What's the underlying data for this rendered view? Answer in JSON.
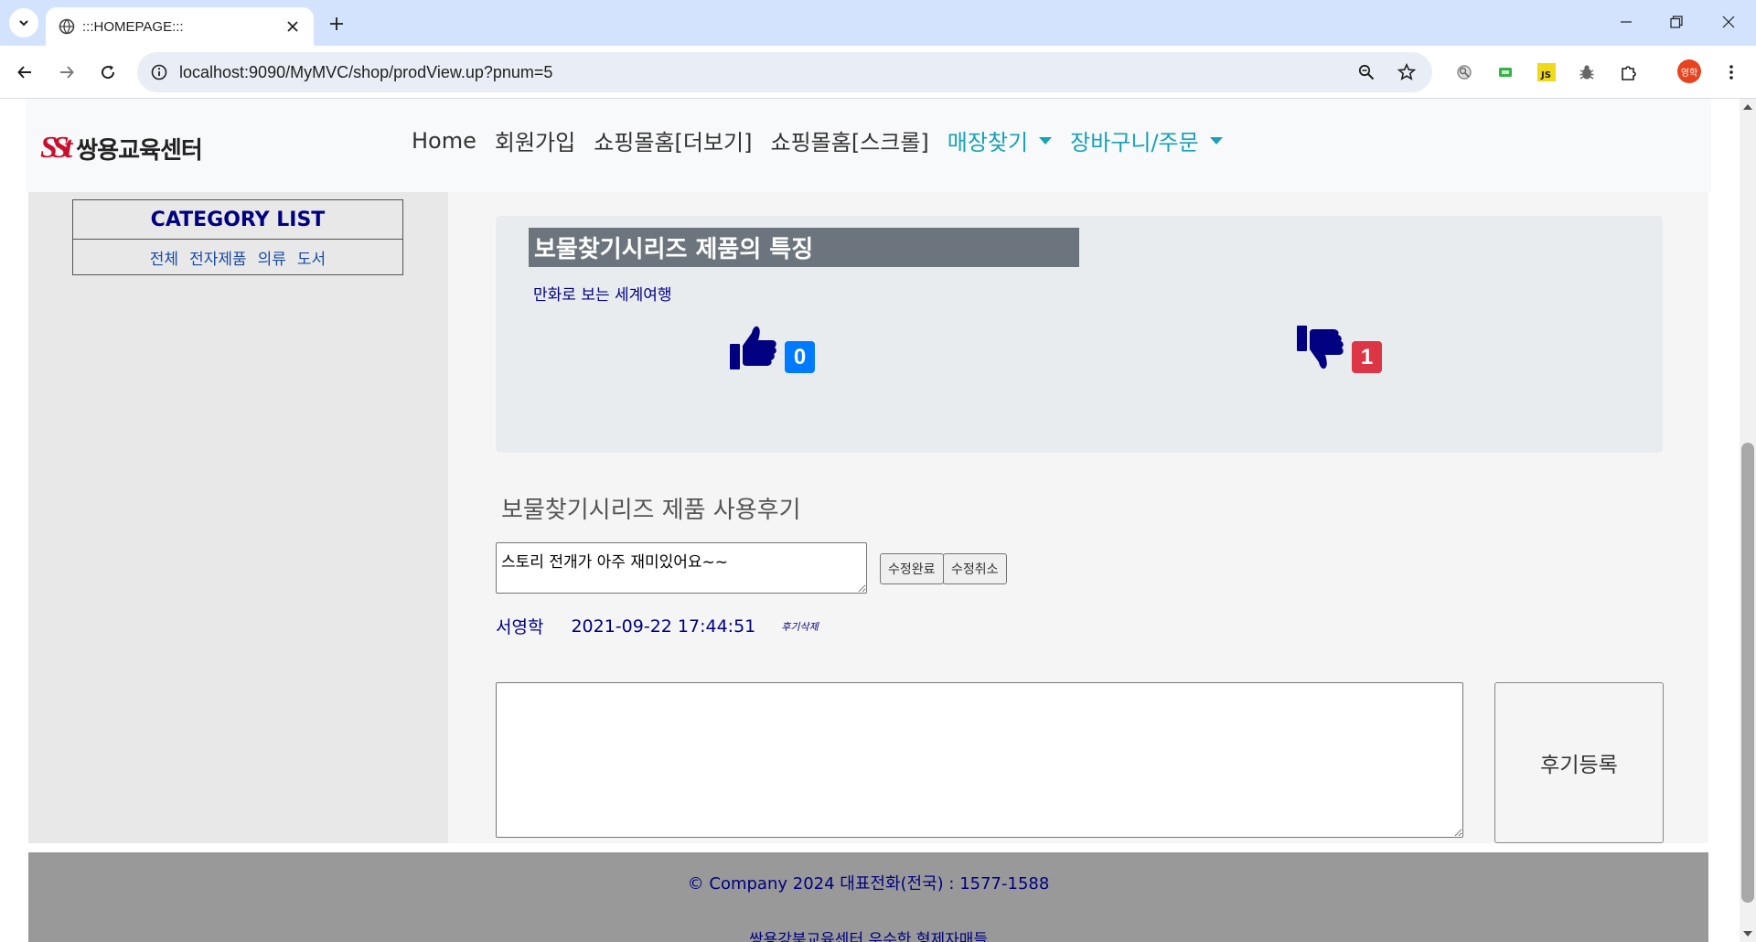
{
  "browser": {
    "tab_title": ":::HOMEPAGE:::",
    "url": "localhost:9090/MyMVC/shop/prodView.up?pnum=5",
    "profile_label": "영학"
  },
  "navbar": {
    "logo_mark": "SSt",
    "logo_text": "쌍용교육센터",
    "links": [
      "Home",
      "회원가입",
      "쇼핑몰홈[더보기]",
      "쇼핑몰홈[스크롤]"
    ],
    "dropdowns": [
      "매장찾기",
      "장바구니/주문"
    ]
  },
  "sidebar": {
    "title": "CATEGORY LIST",
    "categories": [
      "전체",
      "전자제품",
      "의류",
      "도서"
    ]
  },
  "product": {
    "feature_title": "보물찾기시리즈 제품의 특징",
    "feature_desc": "만화로 보는 세계여행",
    "likes": "0",
    "dislikes": "1"
  },
  "reviews": {
    "heading": "보물찾기시리즈 제품 사용후기",
    "edit_text": "스토리 전개가 아주 재미있어요~~",
    "save_label": "수정완료",
    "cancel_label": "수정취소",
    "author": "서영학",
    "date": "2021-09-22 17:44:51",
    "delete_label": "후기삭제",
    "new_review_value": "",
    "submit_label": "후기등록"
  },
  "footer": {
    "line1": "© Company 2024     대표전화(전국) : 1577-1588",
    "line2": "쌍용강북교육센터 우수한 형제자매들"
  },
  "colors": {
    "like_badge": "#007bff",
    "dislike_badge": "#dc3545",
    "navy": "#000080",
    "teal": "#17a2b8"
  }
}
